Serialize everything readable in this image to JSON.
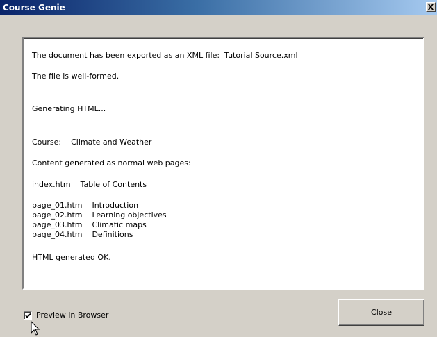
{
  "window": {
    "title": "Course Genie",
    "close_glyph": "X"
  },
  "log": {
    "lines": [
      "The document has been exported as an XML file:  Tutorial Source.xml",
      "The file is well-formed.",
      "Generating HTML...",
      "Course:    Climate and Weather",
      "Content generated as normal web pages:",
      "index.htm    Table of Contents",
      "page_01.htm    Introduction",
      "page_02.htm    Learning objectives",
      "page_03.htm    Climatic maps",
      "page_04.htm    Definitions",
      "HTML generated OK."
    ]
  },
  "footer": {
    "preview_checked": true,
    "preview_label": "Preview in Browser",
    "close_label": "Close"
  },
  "icons": {
    "checkbox": "checkmark-icon",
    "cursor": "mouse-pointer-icon"
  }
}
